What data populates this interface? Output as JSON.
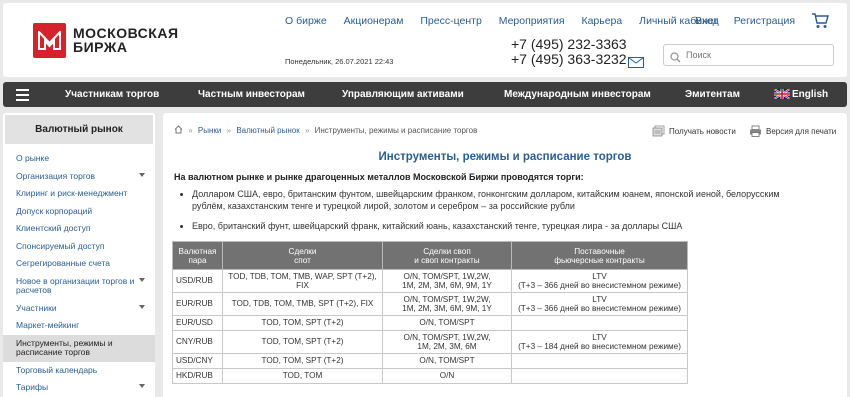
{
  "header": {
    "logo_line1": "МОСКОВСКАЯ",
    "logo_line2": "БИРЖА",
    "top_nav": [
      "О бирже",
      "Акционерам",
      "Пресс-центр",
      "Мероприятия",
      "Карьера",
      "Личный кабинет"
    ],
    "login": "Вход",
    "register": "Регистрация",
    "date": "Понедельник, 26.07.2021 22:43",
    "phone1": "+7 (495) 232-3363",
    "phone2": "+7 (495) 363-3232",
    "search_placeholder": "Поиск"
  },
  "main_nav": [
    "Участникам торгов",
    "Частным инвесторам",
    "Управляющим активами",
    "Международным инвесторам",
    "Эмитентам",
    "English"
  ],
  "sidebar": {
    "title": "Валютный рынок",
    "items": [
      {
        "label": "О рынке"
      },
      {
        "label": "Организация торгов"
      },
      {
        "label": "Клиринг и риск-менеджмент"
      },
      {
        "label": "Допуск корпораций"
      },
      {
        "label": "Клиентский доступ"
      },
      {
        "label": "Спонсируемый доступ"
      },
      {
        "label": "Сегрегированные счета"
      },
      {
        "label": "Новое в организации торгов и расчетов"
      },
      {
        "label": "Участники"
      },
      {
        "label": "Маркет-мейкинг"
      },
      {
        "label": "Инструменты, режимы и расписание торгов"
      },
      {
        "label": "Торговый календарь"
      },
      {
        "label": "Тарифы"
      }
    ]
  },
  "breadcrumb": {
    "sep": "»",
    "markets": "Рынки",
    "fx": "Валютный рынок",
    "current": "Инструменты, режимы и расписание торгов"
  },
  "actions": {
    "news": "Получать новости",
    "print": "Версия для печати"
  },
  "page": {
    "title": "Инструменты, режимы и расписание торгов",
    "intro": "На валютном рынке и рынке драгоценных металлов Московской Биржи проводятся торги:",
    "bullets": [
      "Долларом США, евро, британским фунтом, швейцарским франком, гонконгским долларом, китайским юанем, японской иеной, белорусским рублём, казахстанским тенге и турецкой лирой, золотом и серебром – за российские рубли",
      "Евро, британский фунт, швейцарский франк, китайский юань, казахстанский тенге, турецкая лира - за доллары США"
    ]
  },
  "table": {
    "headers": [
      {
        "l1": "Валютная",
        "l2": "пара"
      },
      {
        "l1": "Сделки",
        "l2": "спот"
      },
      {
        "l1": "Сделки своп",
        "l2": "и своп контракты"
      },
      {
        "l1": "Поставочные",
        "l2": "фьючерсные контракты"
      }
    ],
    "rows": [
      {
        "pair": "USD/RUB",
        "spot": "TOD, TDB, TOM, TMB, WAP, SPT (T+2), FIX",
        "swap1": "O/N, TOM/SPT, 1W,2W,",
        "swap2": "1M, 2M, 3M, 6M, 9M, 1Y",
        "fut1": "LTV",
        "fut2": "(T+3 – 366 дней во внесистемном режиме)"
      },
      {
        "pair": "EUR/RUB",
        "spot": "TOD, TDB, TOM, TMB, SPT (T+2), FIX",
        "swap1": "O/N, TOM/SPT, 1W,2W,",
        "swap2": "1M, 2M, 3M, 6M, 9M, 1Y",
        "fut1": "LTV",
        "fut2": "(T+3 – 366 дней во внесистемном режиме)"
      },
      {
        "pair": "EUR/USD",
        "spot": "TOD, TOM, SPT (T+2)",
        "swap1": "O/N, TOM/SPT",
        "swap2": "",
        "fut1": "",
        "fut2": ""
      },
      {
        "pair": "CNY/RUB",
        "spot": "TOD, TOM, SPT (T+2)",
        "swap1": "O/N, TOM/SPT, 1W,2W,",
        "swap2": "1M, 2M, 3M, 6M",
        "fut1": "LTV",
        "fut2": "(T+3 – 184 дней во внесистемном режиме)"
      },
      {
        "pair": "USD/CNY",
        "spot": "TOD, TOM, SPT (T+2)",
        "swap1": "O/N, TOM/SPT",
        "swap2": "",
        "fut1": "",
        "fut2": ""
      },
      {
        "pair": "HKD/RUB",
        "spot": "TOD, TOM",
        "swap1": "O/N",
        "swap2": "",
        "fut1": "",
        "fut2": ""
      }
    ]
  },
  "colors": {
    "brand_red": "#d4232d",
    "link_blue": "#2b5d8c",
    "nav_dark": "#3d3d3d",
    "table_header": "#727272"
  },
  "icons": [
    "moex-logo-icon",
    "cart-icon",
    "mail-icon",
    "search-icon",
    "menu-icon",
    "uk-flag-icon",
    "home-icon",
    "news-icon",
    "print-icon",
    "chevron-down-icon"
  ]
}
